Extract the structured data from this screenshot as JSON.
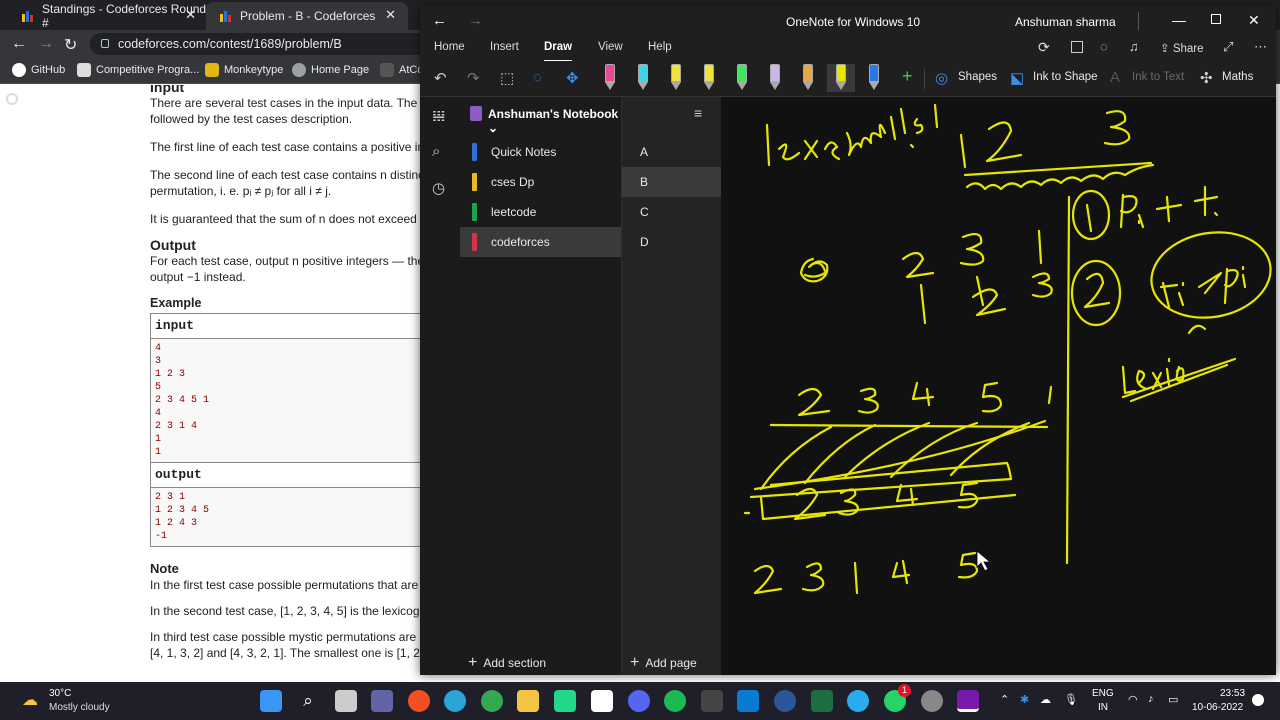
{
  "browser": {
    "tabs": [
      {
        "title": "Standings - Codeforces Round #",
        "active": false
      },
      {
        "title": "Problem - B - Codeforces",
        "active": true
      }
    ],
    "url": "codeforces.com/contest/1689/problem/B",
    "bookmarks": [
      "GitHub",
      "Competitive Progra...",
      "Monkeytype",
      "Home Page",
      "AtCo"
    ]
  },
  "problem": {
    "input_heading": "Input",
    "p1": "There are several test cases in the input data. The fi",
    "p1b": "followed by the test cases description.",
    "p2": "The first line of each test case contains a positive int",
    "p3": "The second line of each test case contains n distinct",
    "p3b": "permutation, i. e. pᵢ ≠ pⱼ for all i ≠ j.",
    "p4": "It is guaranteed that the sum of n does not exceed 1",
    "output_heading": "Output",
    "p5": "For each test case, output n positive integers — the",
    "p5b": "output −1 instead.",
    "example_heading": "Example",
    "input_label": "input",
    "input_lines": [
      "4",
      "3",
      "1 2 3",
      "5",
      "2 3 4 5 1",
      "4",
      "2 3 1 4",
      "1",
      "1"
    ],
    "output_label": "output",
    "output_lines": [
      "2 3 1",
      "1 2 3 4 5",
      "1 2 4 3",
      "-1"
    ],
    "note_heading": "Note",
    "n1": "In the first test case possible permutations that are m",
    "n2": "In the second test case, [1, 2, 3, 4, 5] is the lexicogr",
    "n3": "In third test case possible mystic permutations are [1",
    "n3b": "[4, 1, 3, 2] and [4, 3, 2, 1]. The smallest one is [1, 2"
  },
  "onenote": {
    "window_title": "OneNote for Windows 10",
    "user": "Anshuman sharma",
    "ribbon_tabs": [
      "Home",
      "Insert",
      "Draw",
      "View",
      "Help"
    ],
    "active_tab": "Draw",
    "share_label": "Share",
    "shapes_label": "Shapes",
    "ink_to_shape_label": "Ink to Shape",
    "ink_to_text_label": "Ink to Text",
    "maths_label": "Maths",
    "notebook_name": "Anshuman's Notebook",
    "sections": [
      {
        "name": "Quick Notes",
        "color": "#2f6fd6"
      },
      {
        "name": "cses Dp",
        "color": "#e8b92a"
      },
      {
        "name": "leetcode",
        "color": "#1fa34a"
      },
      {
        "name": "codeforces",
        "color": "#d1344b"
      }
    ],
    "active_section": "codeforces",
    "pages": [
      "A",
      "B",
      "C",
      "D"
    ],
    "active_page": "B",
    "add_section_label": "Add section",
    "add_page_label": "Add page",
    "ink_color": "#e6e600"
  },
  "taskbar": {
    "temperature": "30°C",
    "weather": "Mostly cloudy",
    "lang": "ENG",
    "region": "IN",
    "time": "23:53",
    "date": "10-06-2022",
    "notification_count": "1"
  }
}
